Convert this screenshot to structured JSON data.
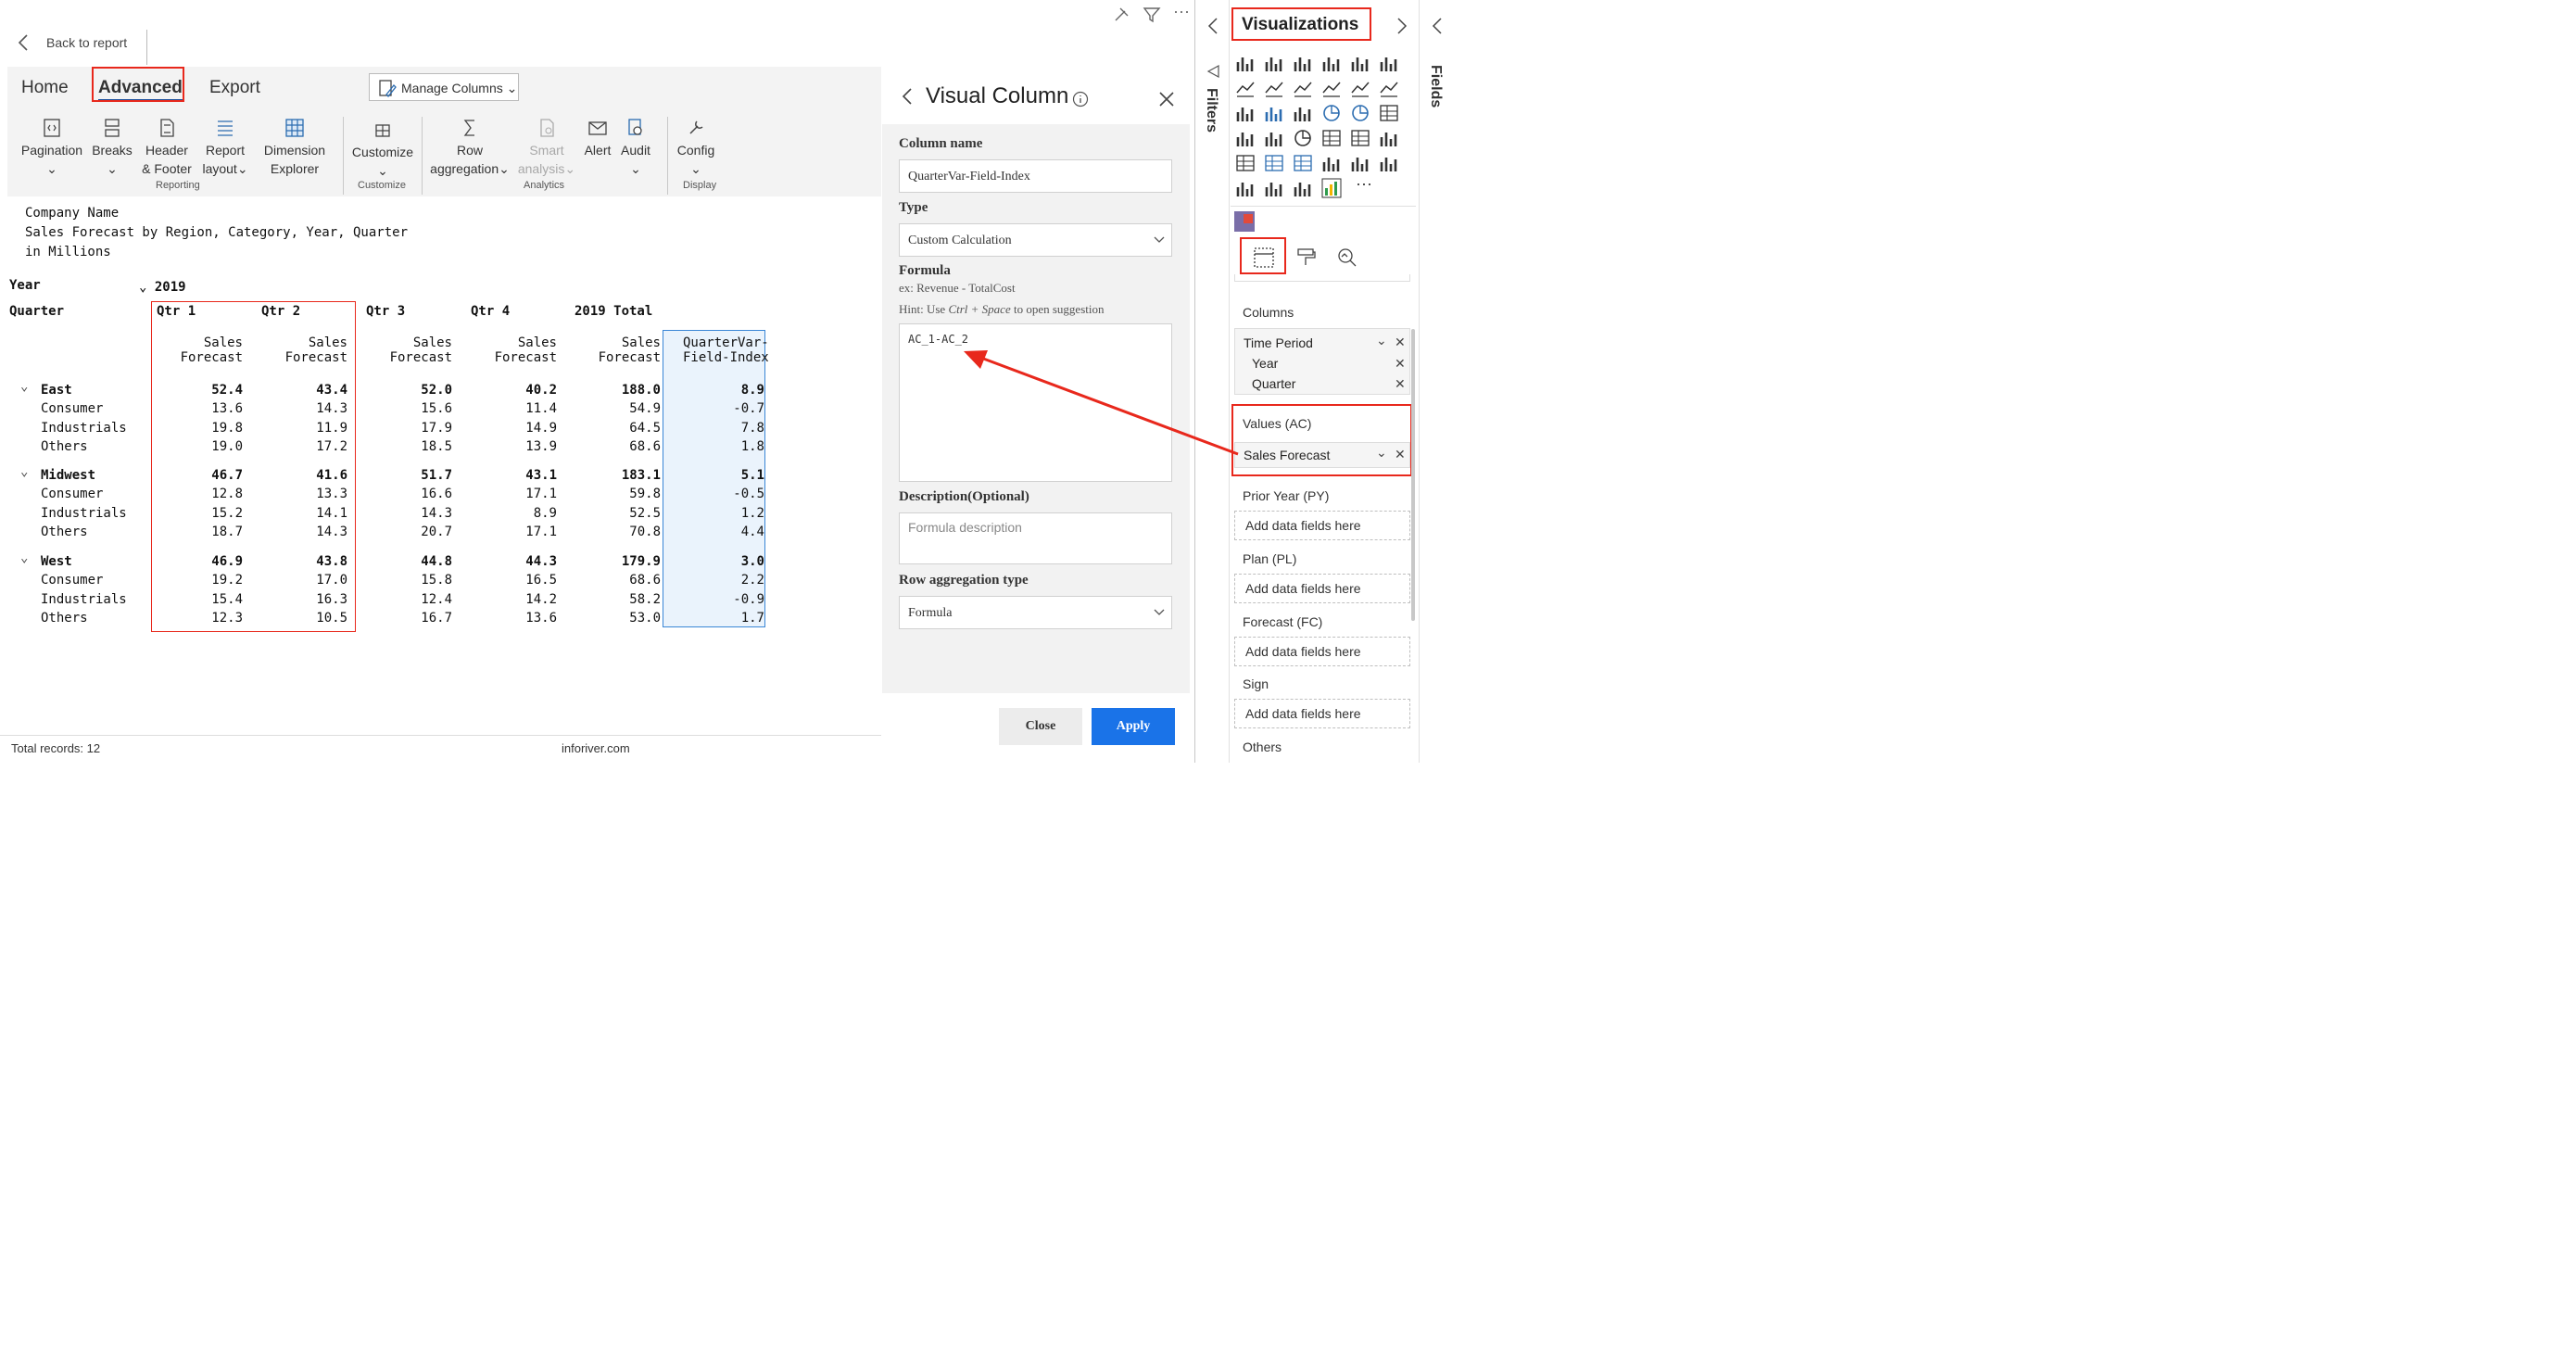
{
  "topbar": {
    "back_label": "Back to report"
  },
  "ribbon": {
    "tabs": [
      "Home",
      "Advanced",
      "Export"
    ],
    "manage_columns": "Manage Columns",
    "buttons": {
      "pagination": "Pagination",
      "breaks": "Breaks",
      "header_footer_1": "Header",
      "header_footer_2": "& Footer",
      "report_layout_1": "Report",
      "report_layout_2": "layout",
      "dim_explorer_1": "Dimension",
      "dim_explorer_2": "Explorer",
      "customize": "Customize",
      "row_agg_1": "Row",
      "row_agg_2": "aggregation",
      "smart_1": "Smart",
      "smart_2": "analysis",
      "alert": "Alert",
      "audit": "Audit",
      "config": "Config"
    },
    "groups": {
      "reporting": "Reporting",
      "customize": "Customize",
      "analytics": "Analytics",
      "display": "Display"
    }
  },
  "report": {
    "title_lines": [
      "Company Name",
      "Sales Forecast by Region, Category, Year, Quarter",
      "in Millions"
    ],
    "year_label": "Year",
    "year_value": "2019",
    "quarter_label": "Quarter",
    "column_headers": [
      "Qtr 1",
      "Qtr 2",
      "Qtr 3",
      "Qtr 4",
      "2019 Total"
    ],
    "measure_line1": "Sales",
    "measure_line2": "Forecast",
    "custom_col_line1": "QuarterVar-",
    "custom_col_line2": "Field-Index",
    "regions": [
      {
        "name": "East",
        "total": [
          "52.4",
          "43.4",
          "52.0",
          "40.2",
          "188.0",
          "8.9"
        ],
        "rows": [
          {
            "name": "Consumer",
            "values": [
              "13.6",
              "14.3",
              "15.6",
              "11.4",
              "54.9",
              "-0.7"
            ]
          },
          {
            "name": "Industrials",
            "values": [
              "19.8",
              "11.9",
              "17.9",
              "14.9",
              "64.5",
              "7.8"
            ]
          },
          {
            "name": "Others",
            "values": [
              "19.0",
              "17.2",
              "18.5",
              "13.9",
              "68.6",
              "1.8"
            ]
          }
        ]
      },
      {
        "name": "Midwest",
        "total": [
          "46.7",
          "41.6",
          "51.7",
          "43.1",
          "183.1",
          "5.1"
        ],
        "rows": [
          {
            "name": "Consumer",
            "values": [
              "12.8",
              "13.3",
              "16.6",
              "17.1",
              "59.8",
              "-0.5"
            ]
          },
          {
            "name": "Industrials",
            "values": [
              "15.2",
              "14.1",
              "14.3",
              "8.9",
              "52.5",
              "1.2"
            ]
          },
          {
            "name": "Others",
            "values": [
              "18.7",
              "14.3",
              "20.7",
              "17.1",
              "70.8",
              "4.4"
            ]
          }
        ]
      },
      {
        "name": "West",
        "total": [
          "46.9",
          "43.8",
          "44.8",
          "44.3",
          "179.9",
          "3.0"
        ],
        "rows": [
          {
            "name": "Consumer",
            "values": [
              "19.2",
              "17.0",
              "15.8",
              "16.5",
              "68.6",
              "2.2"
            ]
          },
          {
            "name": "Industrials",
            "values": [
              "15.4",
              "16.3",
              "12.4",
              "14.2",
              "58.2",
              "-0.9"
            ]
          },
          {
            "name": "Others",
            "values": [
              "12.3",
              "10.5",
              "16.7",
              "13.6",
              "53.0",
              "1.7"
            ]
          }
        ]
      }
    ],
    "footer_records": "Total records: 12",
    "footer_brand": "inforiver.com"
  },
  "visual_column": {
    "title": "Visual Column",
    "column_name_label": "Column name",
    "column_name_value": "QuarterVar-Field-Index",
    "type_label": "Type",
    "type_value": "Custom Calculation",
    "formula_label": "Formula",
    "formula_example": "ex: Revenue - TotalCost",
    "hint_prefix": "Hint: Use ",
    "hint_keys": "Ctrl + Space",
    "hint_suffix": " to open suggestion",
    "formula_value": "AC_1-AC_2",
    "description_label": "Description(Optional)",
    "description_placeholder": "Formula description",
    "row_agg_label": "Row aggregation type",
    "row_agg_value": "Formula",
    "close_label": "Close",
    "apply_label": "Apply"
  },
  "filters_pane": {
    "label": "Filters"
  },
  "fields_pane": {
    "label": "Fields"
  },
  "visualizations": {
    "title": "Visualizations",
    "columns_label": "Columns",
    "column_field": "Time Period",
    "column_sub": [
      "Year",
      "Quarter"
    ],
    "values_label": "Values (AC)",
    "values_field": "Sales Forecast",
    "wells": [
      {
        "label": "Prior Year (PY)",
        "placeholder": "Add data fields here"
      },
      {
        "label": "Plan (PL)",
        "placeholder": "Add data fields here"
      },
      {
        "label": "Forecast (FC)",
        "placeholder": "Add data fields here"
      },
      {
        "label": "Sign",
        "placeholder": "Add data fields here"
      }
    ],
    "others_label": "Others",
    "more_glyph": "···"
  },
  "colors": {
    "accent_red": "#e8281c",
    "apply_blue": "#1a73e8",
    "highlight_blue": "#eaf3fc",
    "highlight_border": "#3a86d6"
  }
}
